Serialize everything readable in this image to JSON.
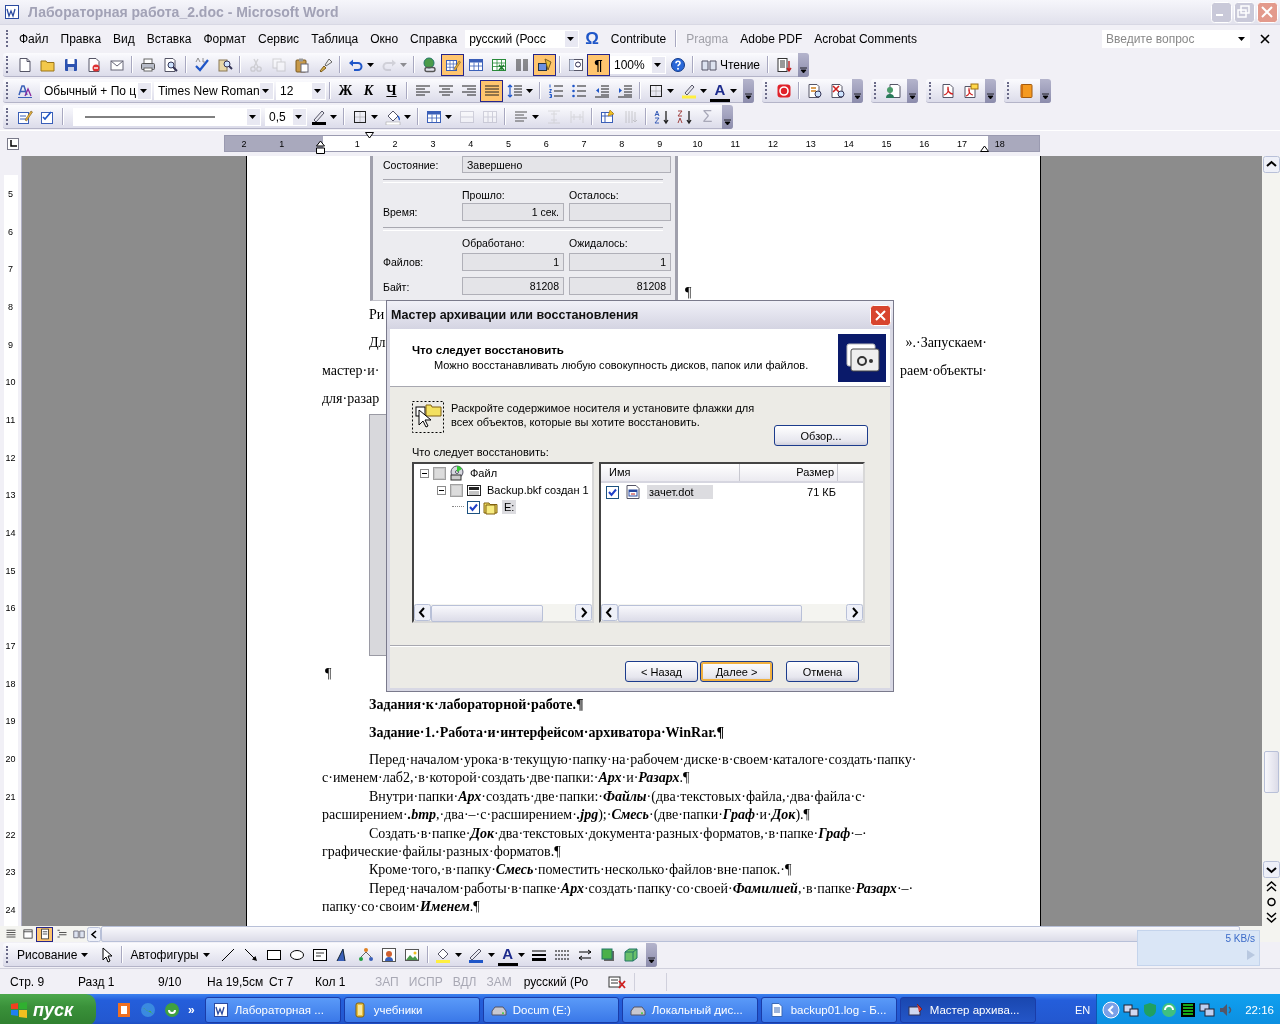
{
  "window": {
    "title": "Лабораторная работа_2.doc - Microsoft Word"
  },
  "menu": {
    "items": [
      "Файл",
      "Правка",
      "Вид",
      "Вставка",
      "Формат",
      "Сервис",
      "Таблица",
      "Окно",
      "Справка"
    ],
    "language": "русский (Росс",
    "symbol": "Ω",
    "extras": [
      {
        "label": "Contribute",
        "disabled": false
      },
      {
        "label": "Pragma",
        "disabled": true
      },
      {
        "label": "Adobe PDF",
        "disabled": false
      },
      {
        "label": "Acrobat Comments",
        "disabled": false
      }
    ],
    "question": {
      "placeholder": "Введите вопрос"
    }
  },
  "standard_toolbar": {
    "tables_borders_on": true,
    "drawing_on": true,
    "show_marks": {
      "label": "¶",
      "on": true
    },
    "zoom": "100%",
    "reading": "Чтение"
  },
  "formatting_toolbar": {
    "style": "Обычный + По ц",
    "font": "Times New Roman",
    "size": "12",
    "bold": "Ж",
    "italic": "К",
    "underline": "Ч",
    "alignment": [
      {
        "selected": false
      },
      {
        "selected": false
      },
      {
        "selected": false
      },
      {
        "selected": true
      }
    ],
    "font_color": "A"
  },
  "tables_toolbar": {
    "line_weight": "0,5",
    "sum": {
      "label": "Σ",
      "disabled": true
    }
  },
  "ruler": {
    "before": [
      "2",
      "1"
    ],
    "after": [
      "1",
      "2",
      "3",
      "4",
      "5",
      "6",
      "7",
      "8",
      "9",
      "10",
      "11",
      "12",
      "13",
      "14",
      "15",
      "16",
      "17",
      "18"
    ]
  },
  "vertical_ruler": [
    "5",
    "6",
    "7",
    "8",
    "9",
    "10",
    "11",
    "12",
    "13",
    "14",
    "15",
    "16",
    "17",
    "18",
    "19",
    "20",
    "21",
    "22",
    "23",
    "24"
  ],
  "document": {
    "progress_image": {
      "status_label": "Состояние:",
      "status": "Завершено",
      "elapsed_label": "Прошло:",
      "remaining_label": "Осталось:",
      "time_label": "Время:",
      "elapsed": "1 сек.",
      "processed_label": "Обработано:",
      "expected_label": "Ожидалось:",
      "files_label": "Файлов:",
      "files_processed": "1",
      "files_expected": "1",
      "bytes_label": "Байт:",
      "bytes_processed": "81208",
      "bytes_expected": "81208"
    },
    "image_mark": "¶",
    "covered_paragraphs": [
      {
        "lines": [
          {
            "left": "Ри"
          }
        ]
      },
      {
        "lines": [
          {
            "left": "Дл",
            "right": "».·Запускаем·"
          },
          {
            "left": "мастер·и·",
            "right": "раем·объекты·"
          },
          {
            "left": "для·разар"
          }
        ]
      }
    ],
    "second_image_mark": "¶",
    "paragraphs": [
      {
        "kind": "heading",
        "lines": [
          "Задания·к·лабораторной·работе.¶"
        ]
      },
      {
        "kind": "heading",
        "lines": [
          "Задание·1.·Работа·и·интерфейсом·архиватора·WinRar.¶"
        ]
      },
      {
        "kind": "body",
        "lines": [
          "Перед·началом·урока·в·текущую·папку·на·рабочем·диске·в·своем·каталоге·создать·папку·",
          "с·именем·лаб2,·в·которой·создать·две·папки:·**Арх**·и·**Разарх**.¶"
        ]
      },
      {
        "kind": "body",
        "lines": [
          "Внутри·папки·**Арх**·создать·две·папки:·**Файлы**·(два·текстовых·файла,·два·файла·с·",
          "расширением·**.bmp**,·два·–·с·расширением·**.jpg**);·**Смесь**·(две·папки·**Граф**·и·**Док**).¶"
        ]
      },
      {
        "kind": "body",
        "lines": [
          "Создать·в·папке·**Док**·два·текстовых·документа·разных·форматов,·в·папке·**Граф**·–·",
          "графические·файлы·разных·форматов.¶"
        ]
      },
      {
        "kind": "body",
        "lines": [
          "Кроме·того,·в·папку·**Смесь**·поместить·несколько·файлов·вне·папок.·¶"
        ]
      },
      {
        "kind": "body",
        "lines": [
          "Перед·началом·работы·в·папке·**Арх**·создать·папку·со·своей·**Фамилией**,·в·папке·**Разарх**·–·",
          "папку·со·своим·**Именем**.¶"
        ]
      }
    ]
  },
  "dialog": {
    "title": "Мастер архивации или восстановления",
    "heading": "Что следует восстановить",
    "subheading": "Можно восстанавливать любую совокупность дисков, папок или файлов.",
    "instruction": "Раскройте содержимое носителя и установите флажки для всех объектов, которые вы хотите восстановить.",
    "browse": "Обзор...",
    "tree_label": "Что следует восстановить:",
    "tree": [
      {
        "label": "Файл",
        "kind": "media",
        "checked": false,
        "partial": true,
        "expanded": true,
        "selected": false,
        "children": [
          {
            "label": "Backup.bkf создан 1",
            "kind": "backup",
            "checked": false,
            "partial": true,
            "expanded": true,
            "selected": false,
            "children": [
              {
                "label": "E:",
                "kind": "drive",
                "checked": true,
                "partial": false,
                "selected": true
              }
            ]
          }
        ]
      }
    ],
    "columns": [
      "Имя",
      "Размер"
    ],
    "files": [
      {
        "name": "зачет.dot",
        "size": "71 КБ",
        "checked": true,
        "selected": true
      }
    ],
    "buttons": [
      {
        "label": "< Назад",
        "default": false
      },
      {
        "label": "Далее >",
        "default": true
      },
      {
        "label": "Отмена",
        "default": false
      }
    ]
  },
  "views": [
    {
      "selected": false
    },
    {
      "selected": false
    },
    {
      "selected": true
    },
    {
      "selected": false
    },
    {
      "selected": false
    }
  ],
  "drawing_toolbar": {
    "draw_menu": "Рисование",
    "autoshapes": "Автофигуры",
    "font_color": "A"
  },
  "status_bar": {
    "fields": [
      "Стр. 9",
      "Разд 1",
      "9/10",
      "На 19,5см",
      "Ст 7",
      "Кол 1"
    ],
    "modes": [
      {
        "label": "ЗАП",
        "on": false
      },
      {
        "label": "ИСПР",
        "on": false
      },
      {
        "label": "ВДЛ",
        "on": false
      },
      {
        "label": "ЗАМ",
        "on": false
      }
    ],
    "language": "русский (Ро"
  },
  "net_widget": {
    "speed": "5 KB/s"
  },
  "taskbar": {
    "start": "пуск",
    "more": "»",
    "tasks": [
      {
        "label": "Лабораторная ...",
        "kind": "word",
        "selected": false
      },
      {
        "label": "учебники",
        "kind": "notebook",
        "selected": false
      },
      {
        "label": "Docum (E:)",
        "kind": "drive",
        "selected": false
      },
      {
        "label": "Локальный дис...",
        "kind": "drive",
        "selected": false
      },
      {
        "label": "backup01.log - Б...",
        "kind": "text",
        "selected": false
      },
      {
        "label": "Мастер архива...",
        "kind": "wizard",
        "selected": true
      }
    ],
    "language": "EN",
    "clock": "22:16"
  }
}
